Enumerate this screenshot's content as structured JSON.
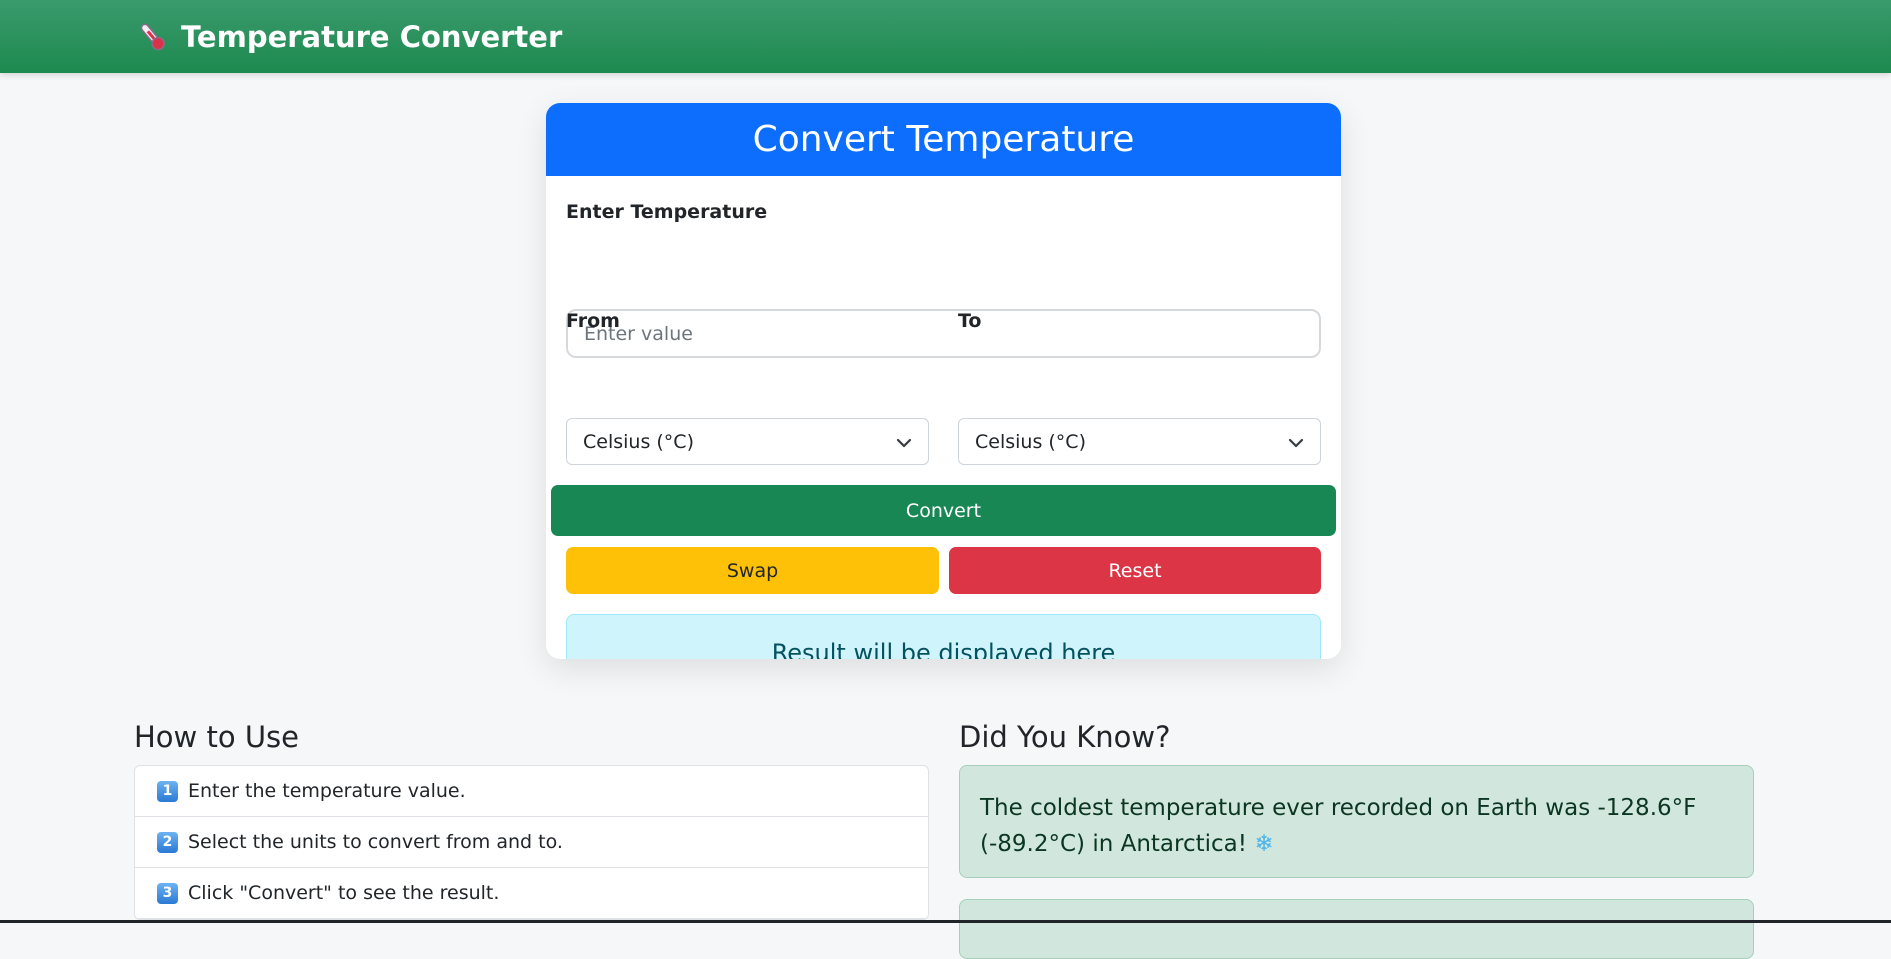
{
  "navbar": {
    "title": "Temperature Converter",
    "icon": "thermometer-icon"
  },
  "converter": {
    "header": "Convert Temperature",
    "input_label": "Enter Temperature",
    "input_placeholder": "Enter value",
    "input_value": "",
    "from_label": "From",
    "from_selected": "Celsius (°C)",
    "to_label": "To",
    "to_selected": "Celsius (°C)",
    "convert_label": "Convert",
    "swap_label": "Swap",
    "reset_label": "Reset",
    "result_text": "Result will be displayed here"
  },
  "how_to_use": {
    "title": "How to Use",
    "steps": [
      {
        "badge": "1",
        "text": "Enter the temperature value."
      },
      {
        "badge": "2",
        "text": "Select the units to convert from and to."
      },
      {
        "badge": "3",
        "text": "Click \"Convert\" to see the result."
      }
    ]
  },
  "did_you_know": {
    "title": "Did You Know?",
    "fact_text": "The coldest temperature ever recorded on Earth was -128.6°F (-89.2°C) in Antarctica!",
    "fact_emoji": "❄"
  },
  "colors": {
    "navbar": "#1d8a4f",
    "card_header": "#0d6efd",
    "convert": "#198754",
    "swap": "#ffc107",
    "reset": "#dc3545",
    "result_bg": "#cff4fc",
    "fact_bg": "#d1e7dd"
  }
}
